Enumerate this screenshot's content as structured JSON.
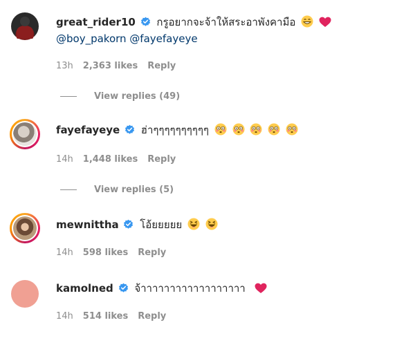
{
  "comments": [
    {
      "username": "great_rider10",
      "text": "กรูอยากจะจ้าให้สระอาพังคามือ",
      "emoji_names": [
        "grin-emoji",
        "heart-emoji"
      ],
      "mentions": "@boy_pakorn @fayefayeye",
      "time": "13h",
      "likes": "2,363 likes",
      "reply": "Reply",
      "view_replies": "View replies (49)"
    },
    {
      "username": "fayefayeye",
      "text": "ฮ่าๆๆๆๆๆๆๆๆๆๆ",
      "emoji_names": [
        "flushed-emoji",
        "flushed-emoji",
        "flushed-emoji",
        "flushed-emoji",
        "flushed-emoji"
      ],
      "time": "14h",
      "likes": "1,448 likes",
      "reply": "Reply",
      "view_replies": "View replies (5)"
    },
    {
      "username": "mewnittha",
      "text": "โอ้ยยยยย",
      "emoji_names": [
        "laughing-emoji",
        "laughing-emoji"
      ],
      "time": "14h",
      "likes": "598 likes",
      "reply": "Reply"
    },
    {
      "username": "kamolned",
      "text": "จ้าาาาาาาาาาาาาาาาาา",
      "emoji_names": [
        "heart-emoji"
      ],
      "time": "14h",
      "likes": "514 likes",
      "reply": "Reply"
    }
  ],
  "colors": {
    "verified": "#3897f0",
    "mention": "#00376b",
    "heart": "#ed4956",
    "placeholder_avatar": "#f0a093"
  }
}
